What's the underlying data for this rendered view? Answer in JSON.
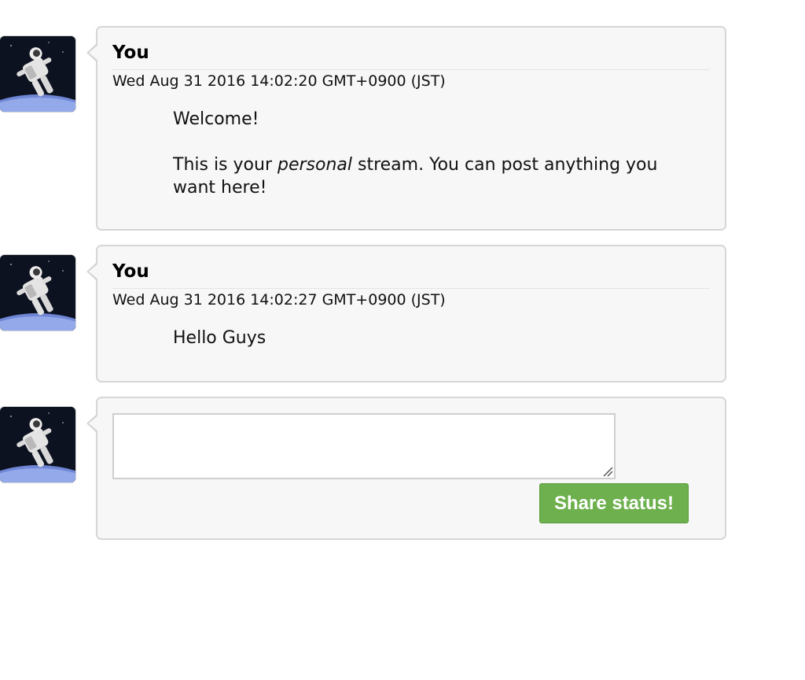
{
  "posts": [
    {
      "author": "You",
      "timestamp": "Wed Aug 31 2016 14:02:20 GMT+0900 (JST)",
      "lines": {
        "first": "Welcome!",
        "second_before": "This is your ",
        "second_emphasis": "personal",
        "second_after": " stream. You can post anything you want here!"
      },
      "avatar_icon": "astronaut-avatar"
    },
    {
      "author": "You",
      "timestamp": "Wed Aug 31 2016 14:02:27 GMT+0900 (JST)",
      "lines": {
        "first": "Hello Guys"
      },
      "avatar_icon": "astronaut-avatar"
    }
  ],
  "composer": {
    "avatar_icon": "astronaut-avatar",
    "input_value": "",
    "input_placeholder": "",
    "share_label": "Share status!"
  },
  "colors": {
    "bubble_background": "#f7f7f7",
    "bubble_border": "#d6d6d6",
    "share_button": "#6db04d"
  }
}
